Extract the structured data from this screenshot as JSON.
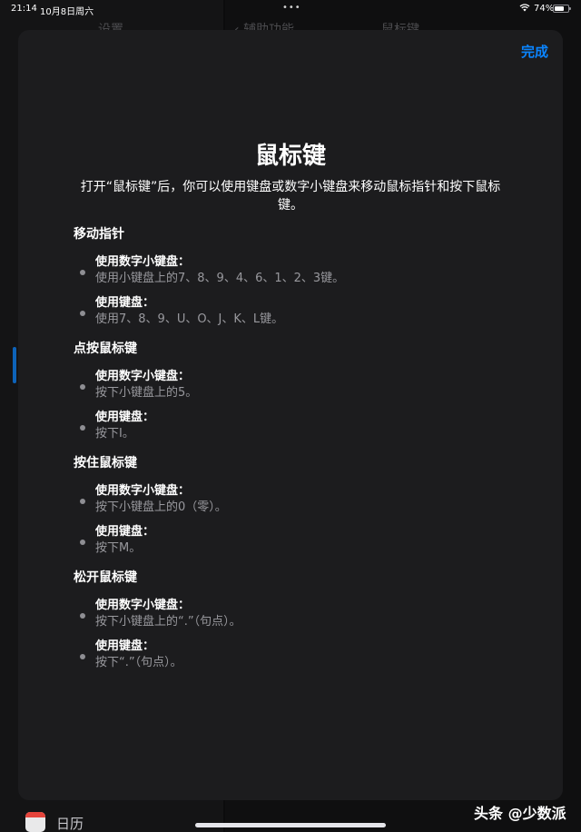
{
  "status_bar": {
    "time": "21:14",
    "date": "10月8日周六",
    "battery_percent": "74%",
    "battery_level": 0.74
  },
  "background": {
    "left_nav_title": "设置",
    "back_label": "辅助功能",
    "right_nav_title": "鼠标键",
    "sidebar_item_label": "日历"
  },
  "sheet": {
    "done_label": "完成",
    "title": "鼠标键",
    "intro": "打开“鼠标键”后，你可以使用键盘或数字小键盘来移动鼠标指针和按下鼠标键。",
    "sections": [
      {
        "title": "移动指针",
        "items": [
          {
            "label": "使用数字小键盘：",
            "desc": "使用小键盘上的7、8、9、4、6、1、2、3键。"
          },
          {
            "label": "使用键盘：",
            "desc": "使用7、8、9、U、O、J、K、L键。"
          }
        ]
      },
      {
        "title": "点按鼠标键",
        "items": [
          {
            "label": "使用数字小键盘：",
            "desc": "按下小键盘上的5。"
          },
          {
            "label": "使用键盘：",
            "desc": "按下I。"
          }
        ]
      },
      {
        "title": "按住鼠标键",
        "items": [
          {
            "label": "使用数字小键盘：",
            "desc": "按下小键盘上的0（零）。"
          },
          {
            "label": "使用键盘：",
            "desc": "按下M。"
          }
        ]
      },
      {
        "title": "松开鼠标键",
        "items": [
          {
            "label": "使用数字小键盘：",
            "desc": "按下小键盘上的“.”（句点）。"
          },
          {
            "label": "使用键盘：",
            "desc": "按下“.”（句点）。"
          }
        ]
      }
    ]
  },
  "watermark": "头条 @少数派",
  "colors": {
    "accent": "#0a84ff",
    "sheet_bg": "#1c1c1e",
    "secondary_text": "#98989d"
  }
}
